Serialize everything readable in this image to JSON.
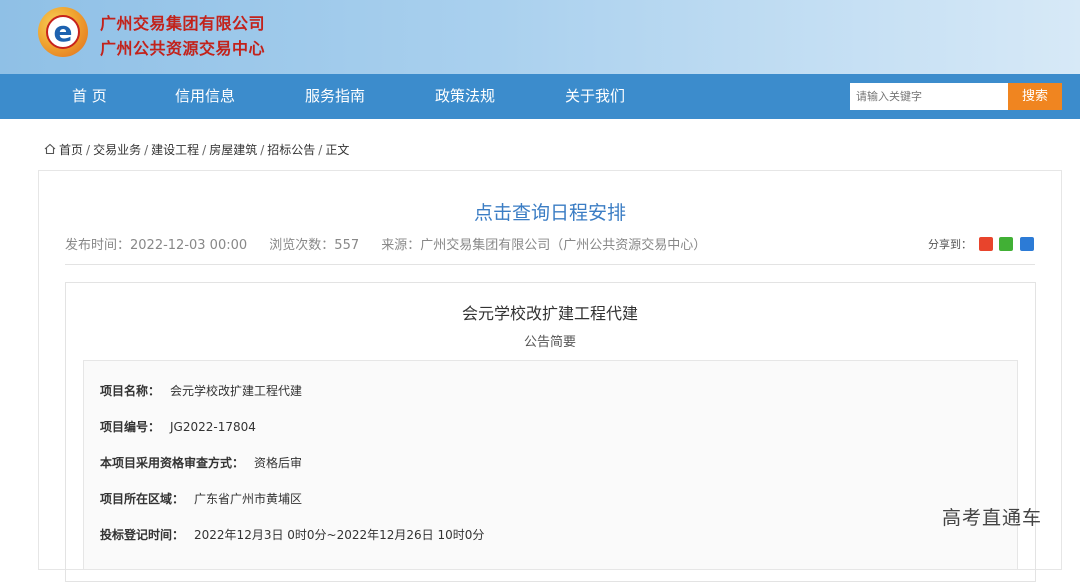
{
  "header": {
    "org_line1": "广州交易集团有限公司",
    "org_line2": "广州公共资源交易中心",
    "logo_letter": "e"
  },
  "nav": {
    "items": [
      "首 页",
      "信用信息",
      "服务指南",
      "政策法规",
      "关于我们"
    ],
    "search_placeholder": "请输入关键字",
    "search_button": "搜索"
  },
  "breadcrumb": [
    "首页",
    "交易业务",
    "建设工程",
    "房屋建筑",
    "招标公告",
    "正文"
  ],
  "article": {
    "title": "点击查询日程安排",
    "publish_time": "发布时间：2022-12-03 00:00",
    "views": "浏览次数：557",
    "source": "来源：广州交易集团有限公司（广州公共资源交易中心）",
    "share_label": "分享到："
  },
  "notice": {
    "title": "会元学校改扩建工程代建",
    "subtitle": "公告简要",
    "fields": [
      {
        "key": "项目名称：",
        "value": "会元学校改扩建工程代建"
      },
      {
        "key": "项目编号：",
        "value": "JG2022-17804"
      },
      {
        "key": "本项目采用资格审查方式：",
        "value": "资格后审"
      },
      {
        "key": "项目所在区域：",
        "value": "广东省广州市黄埔区"
      },
      {
        "key": "投标登记时间：",
        "value": "2022年12月3日 0时0分~2022年12月26日 10时0分"
      }
    ]
  },
  "watermark": "高考直通车",
  "colors": {
    "nav_bg": "#3c8ccc",
    "title_blue": "#3b7dc4",
    "search_orange": "#f08520",
    "org_red": "#c2221b"
  }
}
